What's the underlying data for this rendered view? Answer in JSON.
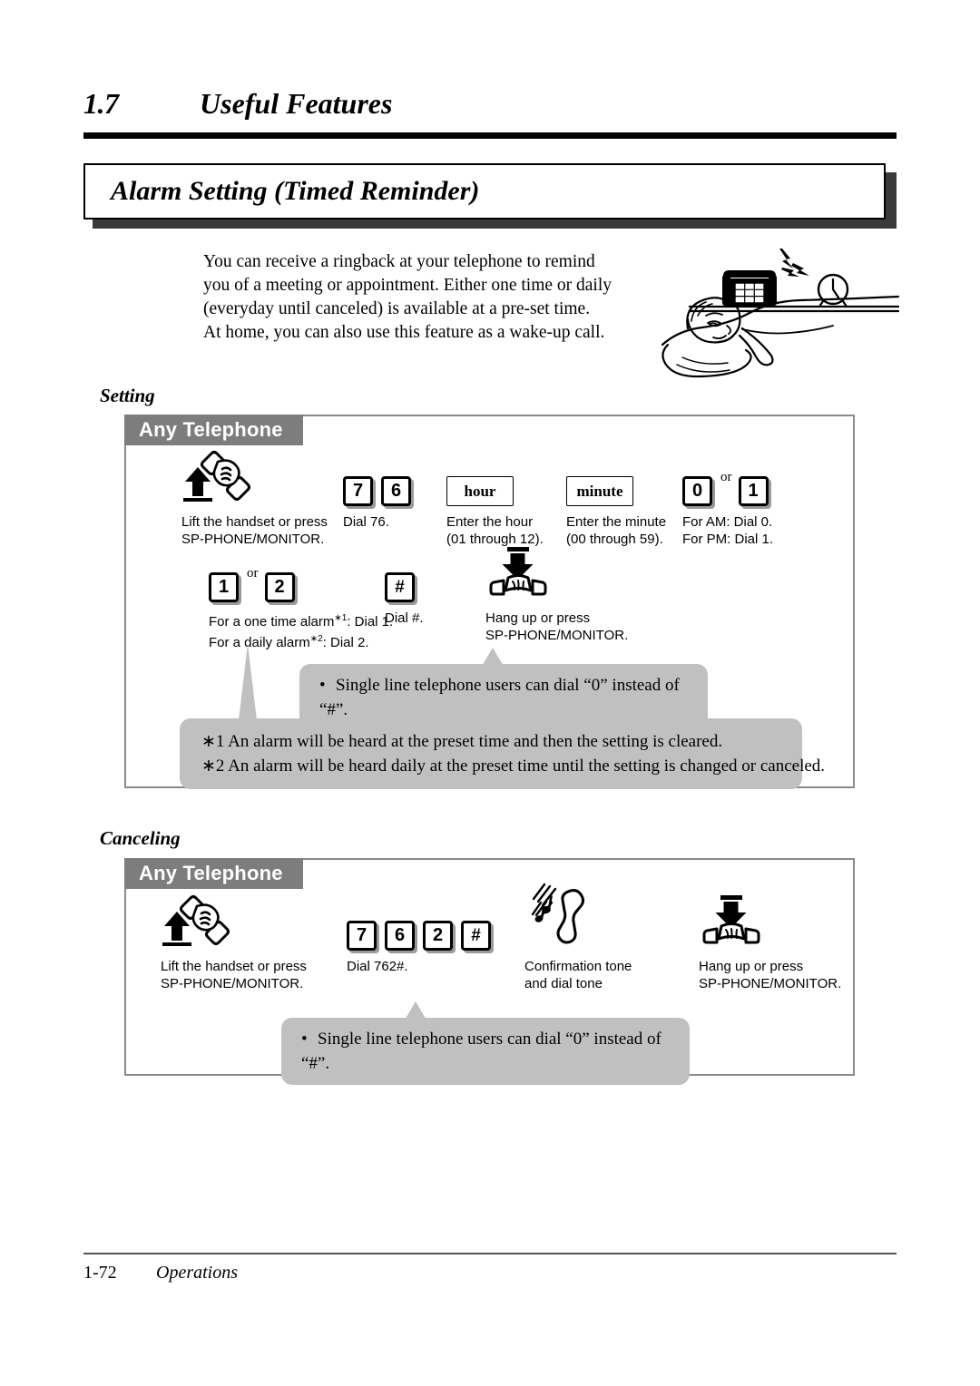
{
  "header": {
    "section_number": "1.7",
    "section_title": "Useful Features",
    "feature_title": "Alarm Setting (Timed Reminder)"
  },
  "intro": {
    "line1": "You can receive a ringback at your telephone to remind",
    "line2": "you of a meeting or appointment.  Either one time or daily",
    "line3": "(everyday until canceled) is available at a pre-set time.",
    "line4": "At home, you can also use this feature as a wake-up call."
  },
  "illustration": {
    "name": "sleeping-person-ringing-phone-alarm-clock"
  },
  "setting": {
    "label": "Setting",
    "panel_tab": "Any Telephone",
    "steps": [
      {
        "icon": "lift-handset-icon",
        "keys": [],
        "caption_line1": "Lift the handset or press",
        "caption_line2": "SP-PHONE/MONITOR."
      },
      {
        "icon": "",
        "keys": [
          "7",
          "6"
        ],
        "caption_line1": "Dial 76.",
        "caption_line2": ""
      },
      {
        "icon": "",
        "word_key": "hour",
        "caption_line1": "Enter the hour",
        "caption_line2": "(01 through 12)."
      },
      {
        "icon": "",
        "word_key": "minute",
        "caption_line1": "Enter the minute",
        "caption_line2": "(00 through 59)."
      },
      {
        "icon": "",
        "keys": [
          "0",
          "1"
        ],
        "separator": "or",
        "caption_line1": "For AM: Dial 0.",
        "caption_line2": "For PM: Dial 1."
      }
    ],
    "steps_row2": [
      {
        "keys": [
          "1",
          "2"
        ],
        "separator": "or",
        "caption_line1_pre": "For a one time alarm",
        "caption_line1_sup": "∗1",
        "caption_line1_post": ": Dial 1.",
        "caption_line2_pre": "For a daily alarm",
        "caption_line2_sup": "∗2",
        "caption_line2_post": ": Dial 2."
      },
      {
        "keys": [
          "#"
        ],
        "caption_line1": "Dial #.",
        "caption_line2": ""
      },
      {
        "icon": "hang-up-icon",
        "caption_line1": "Hang up or press",
        "caption_line2": "SP-PHONE/MONITOR."
      }
    ],
    "note": "Single line telephone users can dial “0” instead of “#”.",
    "footnote1": "∗1 An alarm will be heard at the preset time and then the setting is cleared.",
    "footnote2": "∗2 An alarm will be heard daily at the preset time until the setting is changed or canceled."
  },
  "canceling": {
    "label": "Canceling",
    "panel_tab": "Any Telephone",
    "steps": [
      {
        "icon": "lift-handset-icon",
        "caption_line1": "Lift the handset or press",
        "caption_line2": "SP-PHONE/MONITOR."
      },
      {
        "keys": [
          "7",
          "6",
          "2",
          "#"
        ],
        "caption_line1": "Dial 762#.",
        "caption_line2": ""
      },
      {
        "icon": "confirmation-tone-icon",
        "caption_line1": "Confirmation tone",
        "caption_line2": "and dial tone"
      },
      {
        "icon": "hang-up-icon",
        "caption_line1": "Hang up or press",
        "caption_line2": "SP-PHONE/MONITOR."
      }
    ],
    "note": "Single line telephone users can dial “0” instead of “#”."
  },
  "footer": {
    "page_number": "1-72",
    "document_name": "Operations"
  },
  "colors": {
    "tab_gray": "#7d7d7d",
    "callout_gray": "#c0c0c0",
    "panel_border": "#8a8a8a",
    "title_shadow": "#3a3a3a"
  }
}
